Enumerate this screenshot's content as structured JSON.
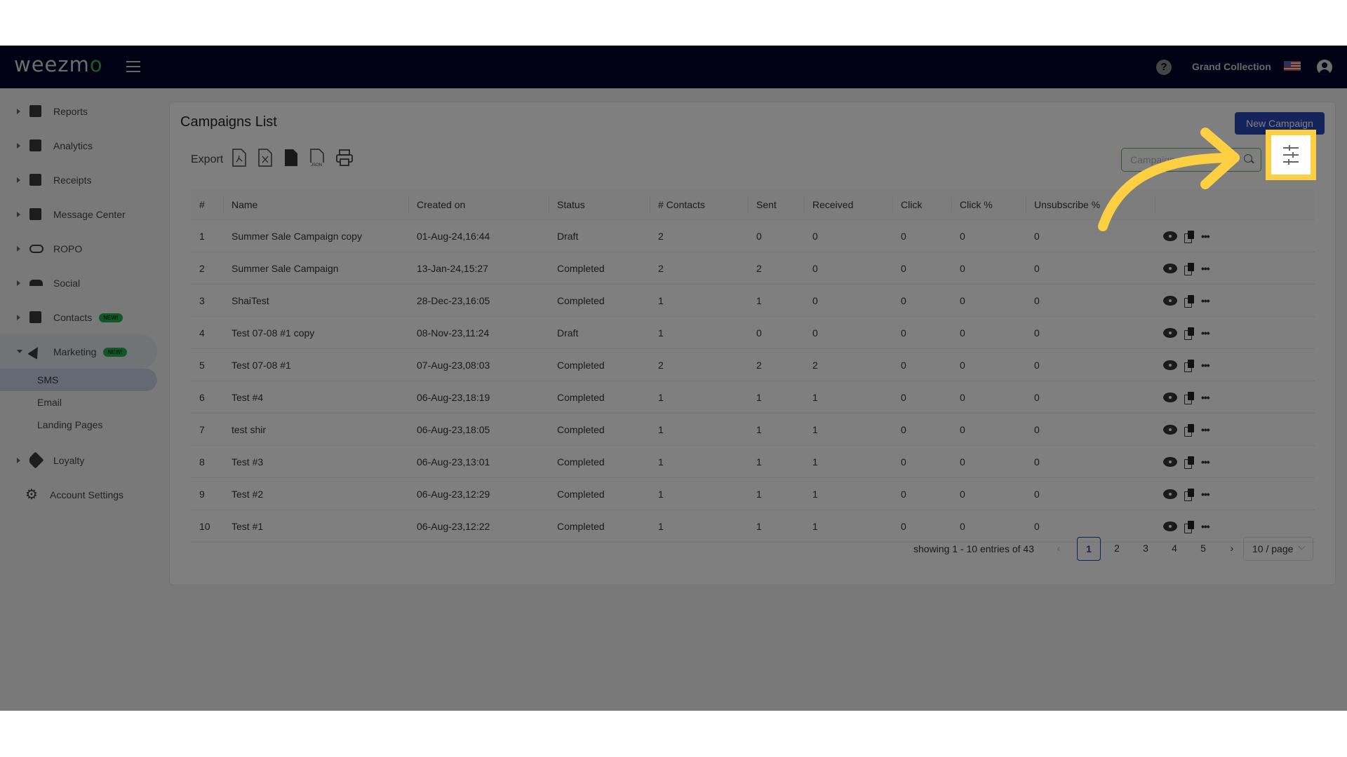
{
  "app": {
    "logo_text": "weezm",
    "logo_accent": "o",
    "org_name": "Grand Collection",
    "help_label": "?"
  },
  "sidebar": {
    "items": [
      {
        "label": "Reports",
        "icon": "dashboard-icon"
      },
      {
        "label": "Analytics",
        "icon": "analytics-icon"
      },
      {
        "label": "Receipts",
        "icon": "receipt-icon"
      },
      {
        "label": "Message Center",
        "icon": "chat-icon"
      },
      {
        "label": "ROPO",
        "icon": "infinity-icon"
      },
      {
        "label": "Social",
        "icon": "group-icon"
      },
      {
        "label": "Contacts",
        "icon": "contacts-icon",
        "badge": "NEW!"
      }
    ],
    "marketing": {
      "label": "Marketing",
      "badge": "NEW!",
      "subitems": [
        {
          "label": "SMS",
          "active": true
        },
        {
          "label": "Email"
        },
        {
          "label": "Landing Pages"
        }
      ]
    },
    "loyalty": {
      "label": "Loyalty"
    },
    "settings": {
      "label": "Account Settings"
    }
  },
  "page": {
    "title": "Campaigns List",
    "export_label": "Export",
    "export_formats": [
      "PDF",
      "Excel",
      "CSV",
      "JSON",
      "Print"
    ],
    "new_campaign_label": "New Campaign",
    "search_placeholder": "Campaign",
    "columns": [
      "#",
      "Name",
      "Created on",
      "Status",
      "# Contacts",
      "Sent",
      "Received",
      "Click",
      "Click %",
      "Unsubscribe %",
      ""
    ],
    "rows": [
      {
        "num": "1",
        "name": "Summer Sale Campaign copy",
        "created": "01-Aug-24,16:44",
        "status": "Draft",
        "contacts": "2",
        "sent": "0",
        "received": "0",
        "click": "0",
        "click_pct": "0",
        "unsub_pct": "0"
      },
      {
        "num": "2",
        "name": "Summer Sale Campaign",
        "created": "13-Jan-24,15:27",
        "status": "Completed",
        "contacts": "2",
        "sent": "2",
        "received": "0",
        "click": "0",
        "click_pct": "0",
        "unsub_pct": "0"
      },
      {
        "num": "3",
        "name": "ShaiTest",
        "created": "28-Dec-23,16:05",
        "status": "Completed",
        "contacts": "1",
        "sent": "1",
        "received": "0",
        "click": "0",
        "click_pct": "0",
        "unsub_pct": "0"
      },
      {
        "num": "4",
        "name": "Test 07-08 #1 copy",
        "created": "08-Nov-23,11:24",
        "status": "Draft",
        "contacts": "1",
        "sent": "0",
        "received": "0",
        "click": "0",
        "click_pct": "0",
        "unsub_pct": "0"
      },
      {
        "num": "5",
        "name": "Test 07-08 #1",
        "created": "07-Aug-23,08:03",
        "status": "Completed",
        "contacts": "2",
        "sent": "2",
        "received": "2",
        "click": "0",
        "click_pct": "0",
        "unsub_pct": "0"
      },
      {
        "num": "6",
        "name": "Test #4",
        "created": "06-Aug-23,18:19",
        "status": "Completed",
        "contacts": "1",
        "sent": "1",
        "received": "1",
        "click": "0",
        "click_pct": "0",
        "unsub_pct": "0"
      },
      {
        "num": "7",
        "name": "test shir",
        "created": "06-Aug-23,18:05",
        "status": "Completed",
        "contacts": "1",
        "sent": "1",
        "received": "1",
        "click": "0",
        "click_pct": "0",
        "unsub_pct": "0"
      },
      {
        "num": "8",
        "name": "Test #3",
        "created": "06-Aug-23,13:01",
        "status": "Completed",
        "contacts": "1",
        "sent": "1",
        "received": "1",
        "click": "0",
        "click_pct": "0",
        "unsub_pct": "0"
      },
      {
        "num": "9",
        "name": "Test #2",
        "created": "06-Aug-23,12:29",
        "status": "Completed",
        "contacts": "1",
        "sent": "1",
        "received": "1",
        "click": "0",
        "click_pct": "0",
        "unsub_pct": "0"
      },
      {
        "num": "10",
        "name": "Test #1",
        "created": "06-Aug-23,12:22",
        "status": "Completed",
        "contacts": "1",
        "sent": "1",
        "received": "1",
        "click": "0",
        "click_pct": "0",
        "unsub_pct": "0"
      }
    ],
    "row_actions": [
      "view-icon",
      "duplicate-icon",
      "more-icon"
    ],
    "pagination": {
      "info": "showing 1 - 10 entries of 43",
      "prev": "‹",
      "next": "›",
      "pages": [
        "1",
        "2",
        "3",
        "4",
        "5"
      ],
      "current": "1",
      "page_size": "10 / page"
    }
  },
  "colors": {
    "header_bg": "#03032a",
    "primary": "#2846b5",
    "completed": "#2f9e44",
    "draft": "#999999",
    "highlight": "#fdd043",
    "badge": "#22b14c"
  }
}
